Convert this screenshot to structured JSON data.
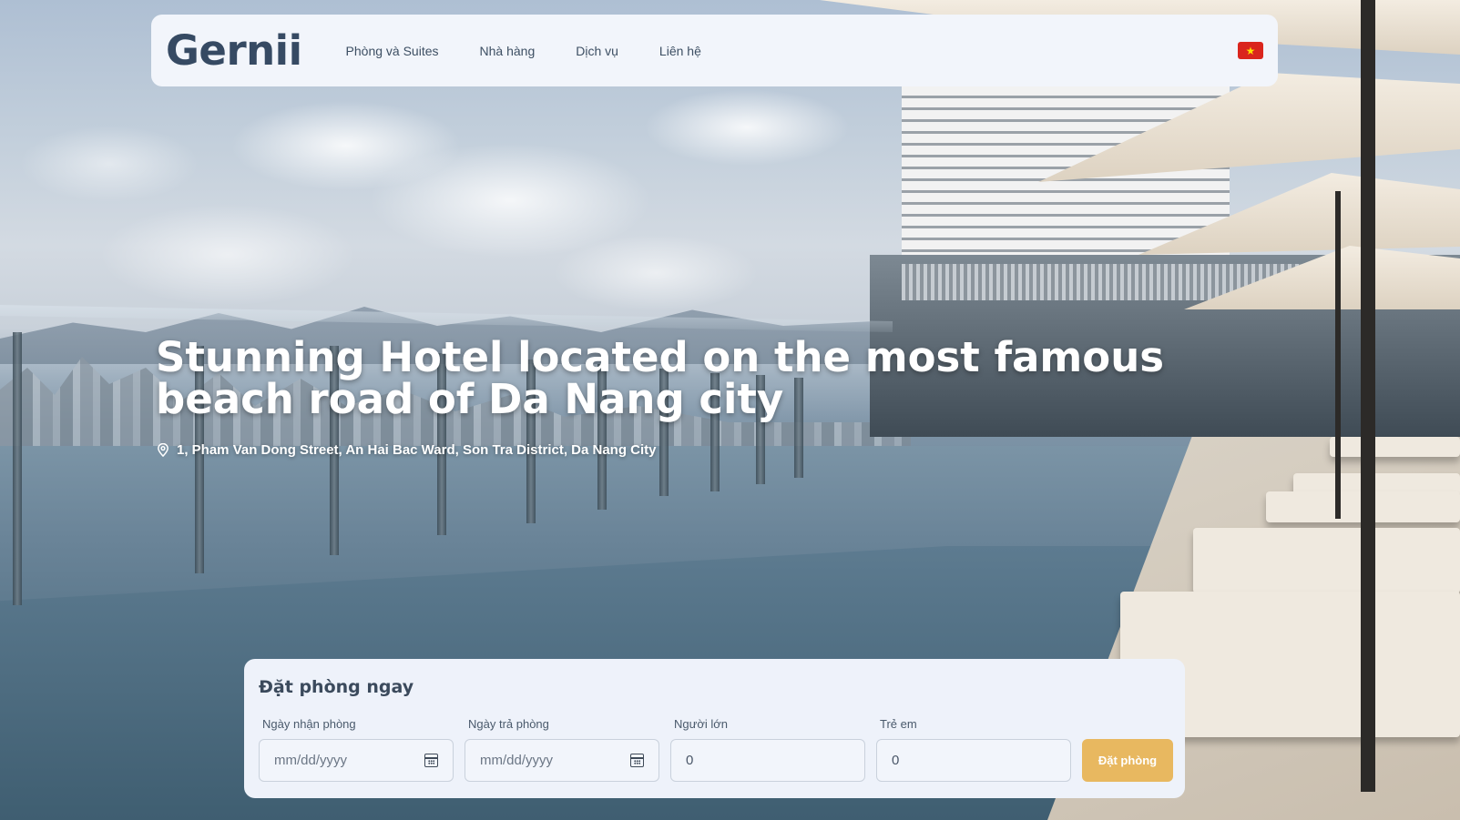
{
  "brand": {
    "name": "Gernii"
  },
  "nav": {
    "items": [
      {
        "label": "Phòng và Suites"
      },
      {
        "label": "Nhà hàng"
      },
      {
        "label": "Dịch vụ"
      },
      {
        "label": "Liên hệ"
      }
    ],
    "language_flag": {
      "icon": "vietnam-flag-icon",
      "star": "★"
    }
  },
  "hero": {
    "title": "Stunning Hotel located on the most famous beach road of Da Nang city",
    "address": "1, Pham Van Dong Street, An Hai Bac Ward, Son Tra District, Da Nang City",
    "address_icon": "map-pin-icon"
  },
  "booking": {
    "title": "Đặt phòng ngay",
    "fields": [
      {
        "label": "Ngày nhận phòng",
        "placeholder": "mm/dd/yyyy",
        "icon": "calendar-icon"
      },
      {
        "label": "Ngày trả phòng",
        "placeholder": "mm/dd/yyyy",
        "icon": "calendar-icon"
      },
      {
        "label": "Người lớn",
        "value": "0"
      },
      {
        "label": "Trẻ em",
        "value": "0"
      }
    ],
    "submit_label": "Đặt phòng"
  },
  "colors": {
    "brand_text": "#364a63",
    "button": "#e8b860",
    "card_bg": "#eef2fa"
  }
}
